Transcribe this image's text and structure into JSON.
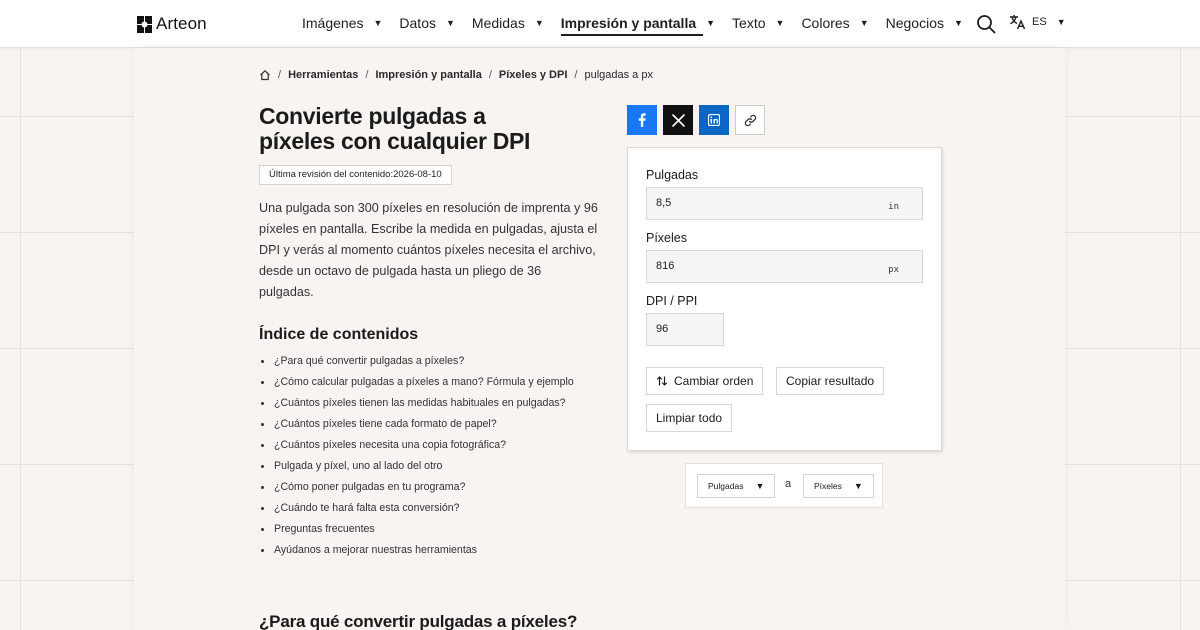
{
  "brand": {
    "name": "Arteon"
  },
  "nav": [
    {
      "label": "Imágenes",
      "active": false
    },
    {
      "label": "Datos",
      "active": false
    },
    {
      "label": "Medidas",
      "active": false
    },
    {
      "label": "Impresión y pantalla",
      "active": true
    },
    {
      "label": "Texto",
      "active": false
    },
    {
      "label": "Colores",
      "active": false
    },
    {
      "label": "Negocios",
      "active": false
    }
  ],
  "header": {
    "lang": "ES",
    "search_icon": "search-icon",
    "translate_icon": "translate-icon"
  },
  "breadcrumb": {
    "home_icon": "home-icon",
    "items": [
      "Herramientas",
      "Impresión y pantalla",
      "Píxeles y DPI",
      "pulgadas a px"
    ]
  },
  "page": {
    "title_line1": "Convierte pulgadas a",
    "title_line2": "píxeles con cualquier DPI",
    "revision": "Última revisión del contenido:2026-08-10",
    "intro": "Una pulgada son 300 píxeles en resolución de imprenta y 96 píxeles en pantalla. Escribe la medida en pulgadas, ajusta el DPI y verás al momento cuántos píxeles necesita el archivo, desde un octavo de pulgada hasta un pliego de 36 pulgadas.",
    "toc_title": "Índice de contenidos",
    "toc": [
      "¿Para qué convertir pulgadas a píxeles?",
      "¿Cómo calcular pulgadas a píxeles a mano? Fórmula y ejemplo",
      "¿Cuántos píxeles tienen las medidas habituales en pulgadas?",
      "¿Cuántos píxeles tiene cada formato de papel?",
      "¿Cuántos píxeles necesita una copia fotográfica?",
      "Pulgada y píxel, uno al lado del otro",
      "¿Cómo poner pulgadas en tu programa?",
      "¿Cuándo te hará falta esta conversión?",
      "Preguntas frecuentes",
      "Ayúdanos a mejorar nuestras herramientas"
    ],
    "section_title": "¿Para qué convertir pulgadas a píxeles?"
  },
  "share": {
    "facebook_icon": "facebook-icon",
    "x_icon": "x-icon",
    "linkedin_icon": "linkedin-icon",
    "link_icon": "link-icon"
  },
  "converter": {
    "inches_label": "Pulgadas",
    "inches_value": "8,5",
    "inches_unit": "in",
    "pixels_label": "Píxeles",
    "pixels_value": "816",
    "pixels_unit": "px",
    "dpi_label": "DPI / PPI",
    "dpi_value": "96",
    "swap_label": "Cambiar orden",
    "copy_label": "Copiar resultado",
    "clear_label": "Limpiar todo"
  },
  "unit_selector": {
    "from": "Pulgadas",
    "connector": "a",
    "to": "Píxeles"
  },
  "colors": {
    "facebook": "#1877f2",
    "x": "#111111",
    "linkedin": "#0a66c2",
    "background": "#f7f4f1"
  }
}
